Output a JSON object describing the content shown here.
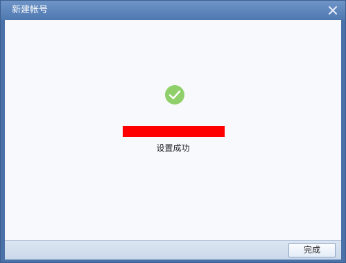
{
  "window": {
    "title": "新建帐号"
  },
  "status": {
    "message": "设置成功"
  },
  "footer": {
    "done_label": "完成"
  },
  "icons": {
    "success": "check-circle-icon",
    "close": "close-icon"
  },
  "colors": {
    "success": "#8fd06a",
    "redaction": "#ff0000",
    "title_bar": "#5a82b8"
  }
}
